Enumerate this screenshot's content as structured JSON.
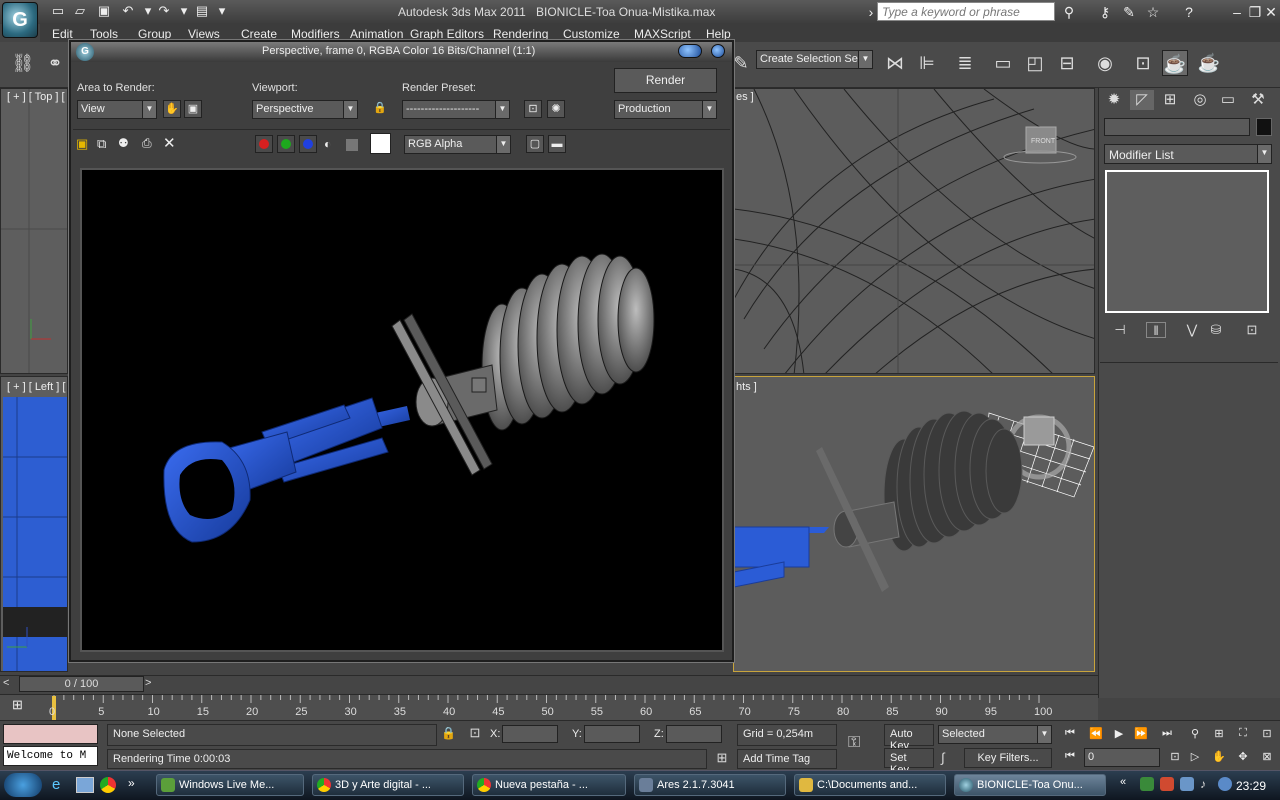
{
  "app": {
    "title": "Autodesk 3ds Max  2011",
    "file": "BIONICLE-Toa Onua-Mistika.max",
    "logo": "G",
    "search_placeholder": "Type a keyword or phrase"
  },
  "menu": [
    "Edit",
    "Tools",
    "Group",
    "Views",
    "Create",
    "Modifiers",
    "Animation",
    "Graph Editors",
    "Rendering",
    "Customize",
    "MAXScript",
    "Help"
  ],
  "toolbar": {
    "selection_set": "Create Selection Se"
  },
  "viewports": {
    "top_label": "[ + ] [ Top ] [",
    "front_label": "es ]",
    "left_label": "[ + ] [ Left ] [",
    "persp_label": "hts ]",
    "viewcube_label": "FRONT"
  },
  "render_window": {
    "title": "Perspective, frame 0, RGBA Color 16 Bits/Channel (1:1)",
    "area_label": "Area to Render:",
    "area_value": "View",
    "viewport_label": "Viewport:",
    "viewport_value": "Perspective",
    "preset_label": "Render Preset:",
    "preset_value": "--------------------",
    "render_button": "Render",
    "production_value": "Production",
    "channel_value": "RGB Alpha",
    "channel_colors": {
      "red": "#d62020",
      "green": "#1ea81e",
      "blue": "#2040e0"
    }
  },
  "command_panel": {
    "modifier_list": "Modifier List"
  },
  "timeline": {
    "slider": "0 / 100",
    "ticks": [
      "0",
      "5",
      "10",
      "15",
      "20",
      "25",
      "30",
      "35",
      "40",
      "45",
      "50",
      "55",
      "60",
      "65",
      "70",
      "75",
      "80",
      "85",
      "90",
      "95",
      "100"
    ]
  },
  "status": {
    "welcome": "Welcome to M",
    "selection": "None Selected",
    "rendering_time": "Rendering Time  0:00:03",
    "x_label": "X:",
    "y_label": "Y:",
    "z_label": "Z:",
    "grid": "Grid = 0,254m",
    "add_time_tag": "Add Time Tag",
    "auto_key": "Auto Key",
    "selected": "Selected",
    "set_key": "Set Key",
    "key_filters": "Key Filters...",
    "frame_value": "0"
  },
  "taskbar": {
    "items": [
      "Windows Live Me...",
      "3D y Arte digital - ...",
      "Nueva pestaña - ...",
      "Ares 2.1.7.3041",
      "C:\\Documents and...",
      "BIONICLE-Toa Onu..."
    ],
    "clock": "23:29"
  }
}
